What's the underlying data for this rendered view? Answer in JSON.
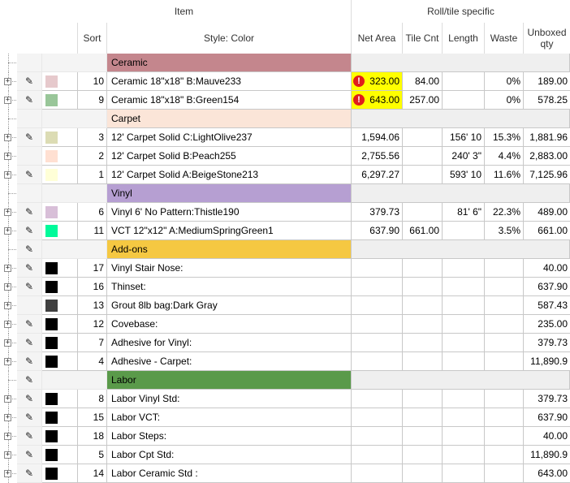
{
  "headers": {
    "group_item": "Item",
    "group_roll": "Roll/tile specific",
    "sort": "Sort",
    "style_color": "Style: Color",
    "net_area": "Net Area",
    "tile_cnt": "Tile Cnt",
    "length": "Length",
    "waste": "Waste",
    "unboxed_line1": "Unboxed",
    "unboxed_line2": "qty"
  },
  "icons": {
    "pencil": "pencil-icon",
    "expand": "expand-icon",
    "warning": "warning-icon"
  },
  "colors": {
    "warning_fill": "#ffff00",
    "warning_icon": "#e01c1c",
    "grid_line": "#c8c8c8"
  },
  "rows": [
    {
      "type": "group",
      "label": "Ceramic",
      "color": "#c4868d",
      "lead_edit": false
    },
    {
      "type": "item",
      "expand": true,
      "edit": true,
      "swatch": "#e6c9cc",
      "sort": "10",
      "style": "Ceramic 18\"x18\" B:Mauve233",
      "net_area": "323.00",
      "warn": true,
      "tile_cnt": "84.00",
      "length": "",
      "waste": "0%",
      "unboxed": "189.00"
    },
    {
      "type": "item",
      "expand": true,
      "edit": true,
      "swatch": "#99c699",
      "sort": "9",
      "style": "Ceramic 18\"x18\" B:Green154",
      "net_area": "643.00",
      "warn": true,
      "tile_cnt": "257.00",
      "length": "",
      "waste": "0%",
      "unboxed": "578.25"
    },
    {
      "type": "group",
      "label": "Carpet",
      "color": "#fbe5d8",
      "lead_edit": false
    },
    {
      "type": "item",
      "expand": true,
      "edit": true,
      "swatch": "#dcdcb4",
      "sort": "3",
      "style": "12' Carpet Solid C:LightOlive237",
      "net_area": "1,594.06",
      "warn": false,
      "tile_cnt": "",
      "length": "156' 10",
      "waste": "15.3%",
      "unboxed": "1,881.96"
    },
    {
      "type": "item",
      "expand": true,
      "edit": false,
      "swatch": "#ffe0d2",
      "sort": "2",
      "style": "12' Carpet Solid B:Peach255",
      "net_area": "2,755.56",
      "warn": false,
      "tile_cnt": "",
      "length": "240' 3\"",
      "waste": "4.4%",
      "unboxed": "2,883.00"
    },
    {
      "type": "item",
      "expand": true,
      "edit": true,
      "swatch": "#ffffd7",
      "sort": "1",
      "style": "12' Carpet Solid A:BeigeStone213",
      "net_area": "6,297.27",
      "warn": false,
      "tile_cnt": "",
      "length": "593' 10",
      "waste": "11.6%",
      "unboxed": "7,125.96"
    },
    {
      "type": "group",
      "label": "Vinyl",
      "color": "#b69fd2",
      "lead_edit": false
    },
    {
      "type": "item",
      "expand": true,
      "edit": true,
      "swatch": "#d8bfd8",
      "sort": "6",
      "style": "Vinyl 6'  No Pattern:Thistle190",
      "net_area": "379.73",
      "warn": false,
      "tile_cnt": "",
      "length": "81' 6\"",
      "waste": "22.3%",
      "unboxed": "489.00"
    },
    {
      "type": "item",
      "expand": true,
      "edit": true,
      "swatch": "#00fa9a",
      "sort": "11",
      "style": "VCT 12\"x12\" A:MediumSpringGreen1",
      "net_area": "637.90",
      "warn": false,
      "tile_cnt": "661.00",
      "length": "",
      "waste": "3.5%",
      "unboxed": "661.00"
    },
    {
      "type": "group",
      "label": "Add-ons",
      "color": "#f5c842",
      "lead_edit": true
    },
    {
      "type": "item",
      "expand": true,
      "edit": true,
      "swatch": "#000000",
      "sort": "17",
      "style": "Vinyl Stair Nose:",
      "net_area": "",
      "warn": false,
      "tile_cnt": "",
      "length": "",
      "waste": "",
      "unboxed": "40.00"
    },
    {
      "type": "item",
      "expand": true,
      "edit": true,
      "swatch": "#000000",
      "sort": "16",
      "style": "Thinset:",
      "net_area": "",
      "warn": false,
      "tile_cnt": "",
      "length": "",
      "waste": "",
      "unboxed": "637.90"
    },
    {
      "type": "item",
      "expand": true,
      "edit": false,
      "swatch": "#404040",
      "sort": "13",
      "style": "Grout 8lb bag:Dark Gray",
      "net_area": "",
      "warn": false,
      "tile_cnt": "",
      "length": "",
      "waste": "",
      "unboxed": "587.43"
    },
    {
      "type": "item",
      "expand": true,
      "edit": true,
      "swatch": "#000000",
      "sort": "12",
      "style": "Covebase:",
      "net_area": "",
      "warn": false,
      "tile_cnt": "",
      "length": "",
      "waste": "",
      "unboxed": "235.00"
    },
    {
      "type": "item",
      "expand": true,
      "edit": true,
      "swatch": "#000000",
      "sort": "7",
      "style": "Adhesive for Vinyl:",
      "net_area": "",
      "warn": false,
      "tile_cnt": "",
      "length": "",
      "waste": "",
      "unboxed": "379.73"
    },
    {
      "type": "item",
      "expand": true,
      "edit": true,
      "swatch": "#000000",
      "sort": "4",
      "style": "Adhesive - Carpet:",
      "net_area": "",
      "warn": false,
      "tile_cnt": "",
      "length": "",
      "waste": "",
      "unboxed": "11,890.9"
    },
    {
      "type": "group",
      "label": "Labor",
      "color": "#5a9a4a",
      "lead_edit": true
    },
    {
      "type": "item",
      "expand": true,
      "edit": true,
      "swatch": "#000000",
      "sort": "8",
      "style": "Labor Vinyl Std:",
      "net_area": "",
      "warn": false,
      "tile_cnt": "",
      "length": "",
      "waste": "",
      "unboxed": "379.73"
    },
    {
      "type": "item",
      "expand": true,
      "edit": true,
      "swatch": "#000000",
      "sort": "15",
      "style": "Labor VCT:",
      "net_area": "",
      "warn": false,
      "tile_cnt": "",
      "length": "",
      "waste": "",
      "unboxed": "637.90"
    },
    {
      "type": "item",
      "expand": true,
      "edit": true,
      "swatch": "#000000",
      "sort": "18",
      "style": "Labor Steps:",
      "net_area": "",
      "warn": false,
      "tile_cnt": "",
      "length": "",
      "waste": "",
      "unboxed": "40.00"
    },
    {
      "type": "item",
      "expand": true,
      "edit": true,
      "swatch": "#000000",
      "sort": "5",
      "style": "Labor Cpt Std:",
      "net_area": "",
      "warn": false,
      "tile_cnt": "",
      "length": "",
      "waste": "",
      "unboxed": "11,890.9"
    },
    {
      "type": "item",
      "expand": true,
      "edit": true,
      "swatch": "#000000",
      "sort": "14",
      "style": "Labor Ceramic Std :",
      "net_area": "",
      "warn": false,
      "tile_cnt": "",
      "length": "",
      "waste": "",
      "unboxed": "643.00"
    }
  ]
}
